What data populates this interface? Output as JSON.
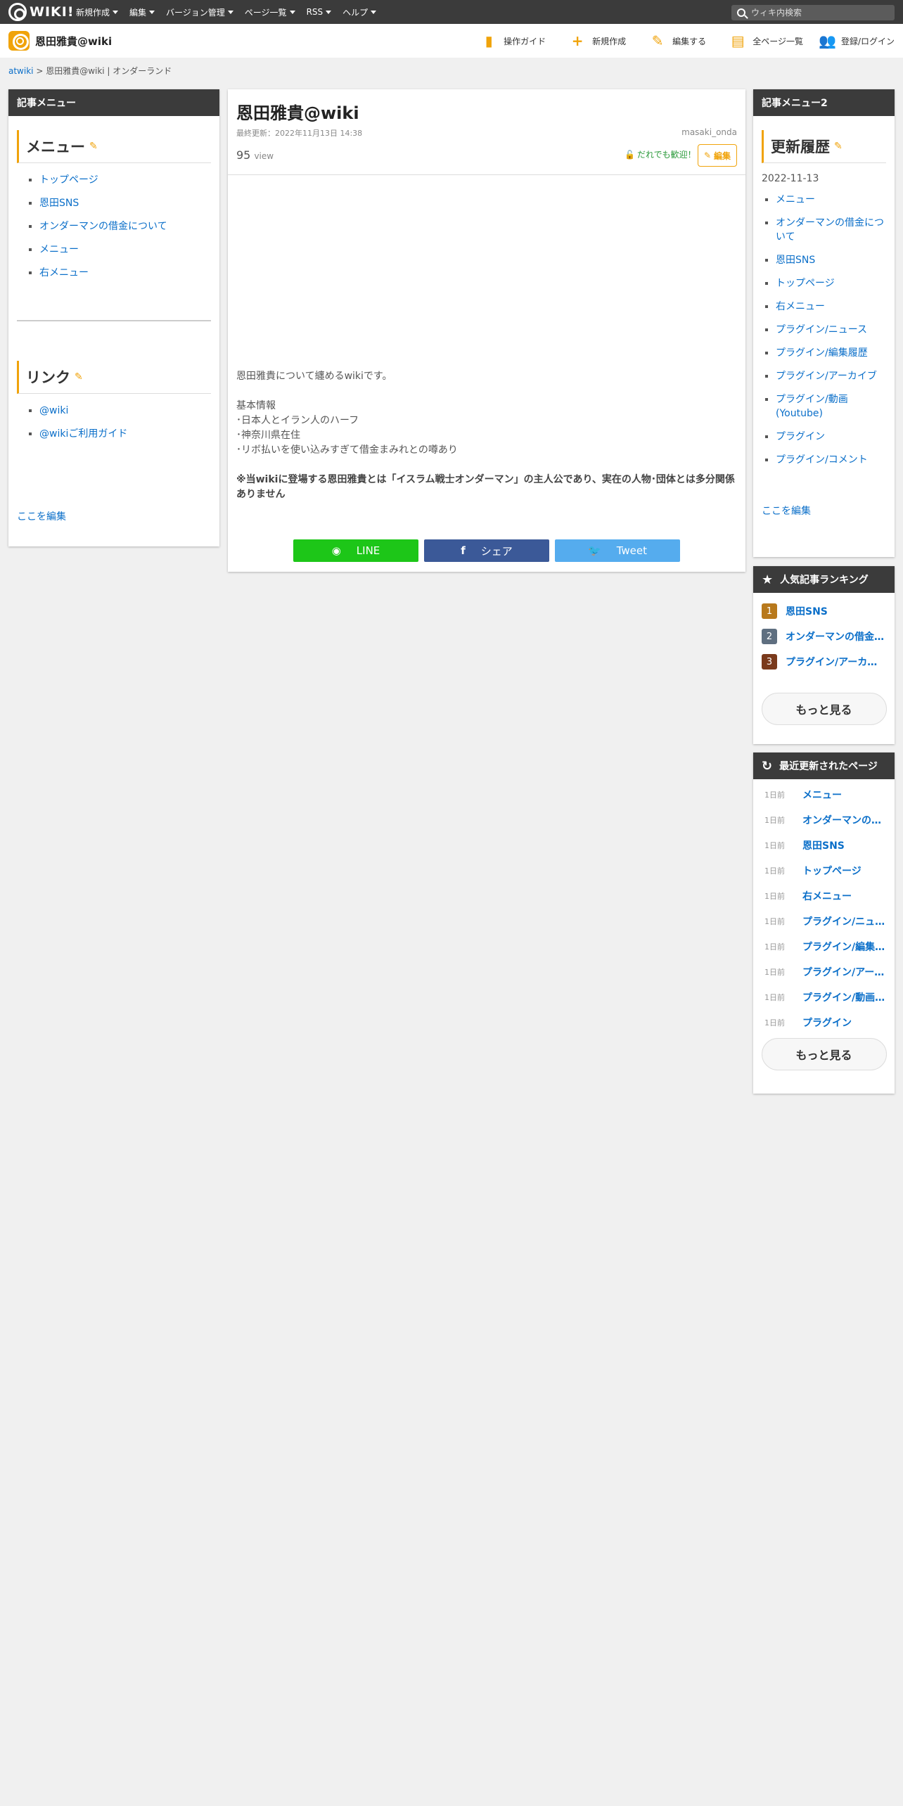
{
  "topbar": {
    "logo_text": "WIKI!",
    "nav": [
      "新規作成",
      "編集",
      "バージョン管理",
      "ページ一覧",
      "RSS",
      "ヘルプ"
    ],
    "search_placeholder": "ウィキ内検索"
  },
  "header": {
    "site_name": "恩田雅貴@wiki",
    "nav": [
      {
        "label": "操作ガイド",
        "icon": "guide-icon"
      },
      {
        "label": "新規作成",
        "icon": "plus-icon"
      },
      {
        "label": "編集する",
        "icon": "pencil-icon"
      },
      {
        "label": "全ページ一覧",
        "icon": "document-icon"
      },
      {
        "label": "登録/ログイン",
        "icon": "users-icon"
      }
    ]
  },
  "breadcrumb": {
    "root": "atwiki",
    "separator": " > ",
    "current": "恩田雅貴@wiki | オンダーランド"
  },
  "left_panel": {
    "title": "記事メニュー",
    "menu_title": "メニュー",
    "menu_items": [
      "トップページ",
      "恩田SNS",
      "オンダーマンの借金について",
      "メニュー",
      "右メニュー"
    ],
    "links_title": "リンク",
    "link_items": [
      "@wiki",
      "@wikiご利用ガイド"
    ],
    "edit_here": "ここを編集"
  },
  "article": {
    "title": "恩田雅貴@wiki",
    "updated": "最終更新：2022年11月13日 14:38",
    "author": "masaki_onda",
    "views": "95",
    "views_unit": "view",
    "welcome": "だれでも歓迎！",
    "edit_button": "編集",
    "body": {
      "intro": "恩田雅貴について纏めるwikiです。",
      "basic_heading": "基本情報",
      "facts": [
        "･日本人とイラン人のハーフ",
        "･神奈川県在住",
        "･リボ払いを使い込みすぎて借金まみれとの噂あり"
      ],
      "disclaimer": "※当wikiに登場する恩田雅貴とは「イスラム戦士オンダーマン」の主人公であり、実在の人物･団体とは多分関係ありません"
    },
    "share": {
      "line": "LINE",
      "facebook": "シェア",
      "twitter": "Tweet"
    }
  },
  "right_panel": {
    "title": "記事メニュー2",
    "history_title": "更新履歴",
    "history_date": "2022-11-13",
    "history_items": [
      "メニュー",
      "オンダーマンの借金について",
      "恩田SNS",
      "トップページ",
      "右メニュー",
      "プラグイン/ニュース",
      "プラグイン/編集履歴",
      "プラグイン/アーカイブ",
      "プラグイン/動画(Youtube)",
      "プラグイン",
      "プラグイン/コメント"
    ],
    "edit_here": "ここを編集"
  },
  "ranking": {
    "title": "人気記事ランキング",
    "items": [
      {
        "rank": "1",
        "title": "恩田SNS",
        "color": "#b8791c"
      },
      {
        "rank": "2",
        "title": "オンダーマンの借金について",
        "color": "#5f6f80"
      },
      {
        "rank": "3",
        "title": "プラグイン/アーカイブ",
        "color": "#7a3a1c"
      }
    ],
    "more": "もっと見る"
  },
  "recent": {
    "title": "最近更新されたページ",
    "items": [
      {
        "time": "1日前",
        "title": "メニュー"
      },
      {
        "time": "1日前",
        "title": "オンダーマンの借金について"
      },
      {
        "time": "1日前",
        "title": "恩田SNS"
      },
      {
        "time": "1日前",
        "title": "トップページ"
      },
      {
        "time": "1日前",
        "title": "右メニュー"
      },
      {
        "time": "1日前",
        "title": "プラグイン/ニュース"
      },
      {
        "time": "1日前",
        "title": "プラグイン/編集履歴"
      },
      {
        "time": "1日前",
        "title": "プラグイン/アーカイブ"
      },
      {
        "time": "1日前",
        "title": "プラグイン/動画(Youtube)"
      },
      {
        "time": "1日前",
        "title": "プラグイン"
      }
    ],
    "more": "もっと見る"
  },
  "colors": {
    "accent": "#f0a30a",
    "header_dark": "#3b3b3b",
    "link": "#0b6fc9"
  }
}
